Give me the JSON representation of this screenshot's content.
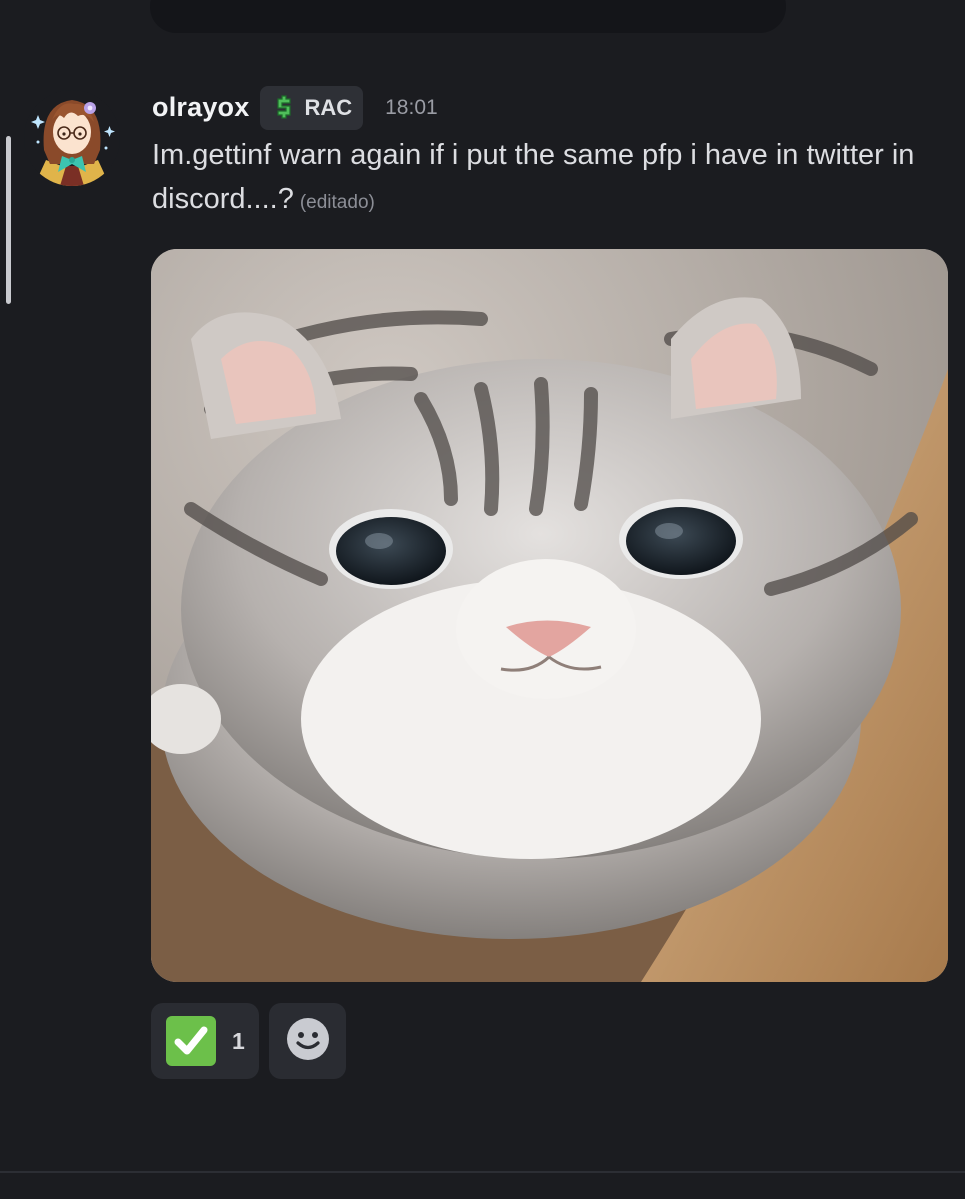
{
  "message": {
    "author": "olrayox",
    "tag": {
      "label": "RAC",
      "icon": "dollar-sign-icon"
    },
    "timestamp": "18:01",
    "text": "Im.gettinf warn again if i put the same pfp i  have in twitter in discord....?",
    "edited_label": "(editado)",
    "attachment": {
      "type": "image",
      "subject": "cat"
    }
  },
  "reactions": [
    {
      "emoji": "white-check-mark",
      "count": "1"
    }
  ],
  "colors": {
    "background": "#1b1c20",
    "reaction_bg": "#2a2c32",
    "tag_bg": "#2e3036",
    "check_green": "#6cc04a"
  }
}
